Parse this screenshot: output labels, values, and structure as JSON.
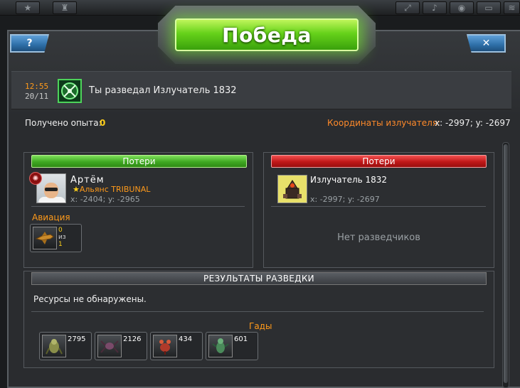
{
  "dialog": {
    "title": "Победа",
    "help_label": "?",
    "close_label": "✕"
  },
  "event": {
    "time": "12:55",
    "date": "20/11",
    "icon": "scout-radar-icon",
    "title": "Ты разведал Излучатель 1832"
  },
  "experience": {
    "label": "Получено опыта:",
    "value": "0"
  },
  "emitter_coords": {
    "label": "Координаты излучателя:",
    "value": "x: -2997; y: -2697"
  },
  "attacker": {
    "header": "Потери",
    "name": "Артём",
    "alliance": "Альянс TRIBUNAL",
    "coords": "x: -2404; y: -2965",
    "unit_group": "Авиация",
    "units": [
      {
        "icon": "aircraft-icon",
        "count": "0",
        "of": "из",
        "total": "1"
      }
    ]
  },
  "defender": {
    "header": "Потери",
    "name": "Излучатель 1832",
    "coords": "x: -2997; y: -2697",
    "empty_text": "Нет разведчиков"
  },
  "results": {
    "header": "РЕЗУЛЬТАТЫ РАЗВЕДКИ",
    "resources_text": "Ресурсы не обнаружены.",
    "creatures_label": "Гады",
    "creatures": [
      {
        "icon": "mutant-beast-icon",
        "count": "2795"
      },
      {
        "icon": "spider-creature-icon",
        "count": "2126"
      },
      {
        "icon": "red-crab-creature-icon",
        "count": "434"
      },
      {
        "icon": "green-mutant-icon",
        "count": "601"
      }
    ]
  }
}
